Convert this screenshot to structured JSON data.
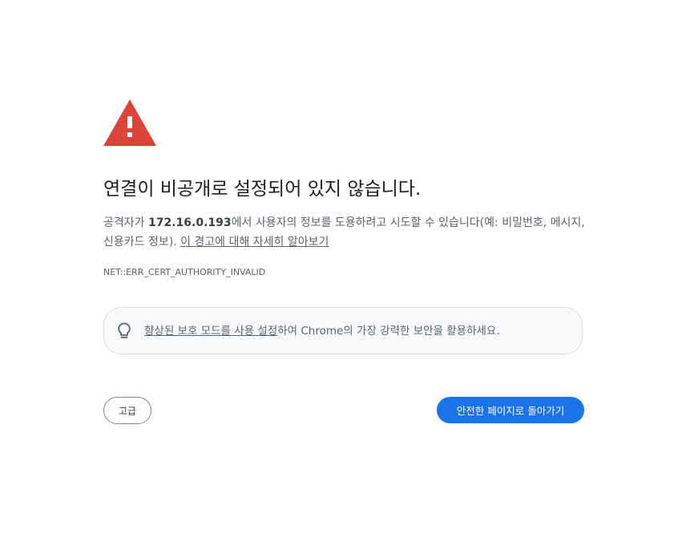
{
  "colors": {
    "warning_red": "#db4437",
    "primary_blue": "#1a73e8",
    "text_primary": "#202124",
    "text_secondary": "#5f6368",
    "promo_background": "#f8f9fa",
    "promo_border": "#dadce0"
  },
  "icons": {
    "warning": "warning-triangle-icon",
    "bulb": "lightbulb-icon"
  },
  "heading": "연결이 비공개로 설정되어 있지 않습니다.",
  "explanation": {
    "prefix": "공격자가 ",
    "host": "172.16.0.193",
    "suffix": "에서 사용자의 정보를 도용하려고 시도할 수 있습니다(예: 비밀번호, 메시지, 신용카드 정보). ",
    "learn_more_link": "이 경고에 대해 자세히 알아보기"
  },
  "error_code": "NET::ERR_CERT_AUTHORITY_INVALID",
  "promo": {
    "link_text": "향상된 보호 모드를 사용 설정",
    "rest_text": "하여 Chrome의 가장 강력한 보안을 활용하세요."
  },
  "buttons": {
    "advanced_label": "고급",
    "back_to_safety_label": "안전한 페이지로 돌아가기"
  }
}
